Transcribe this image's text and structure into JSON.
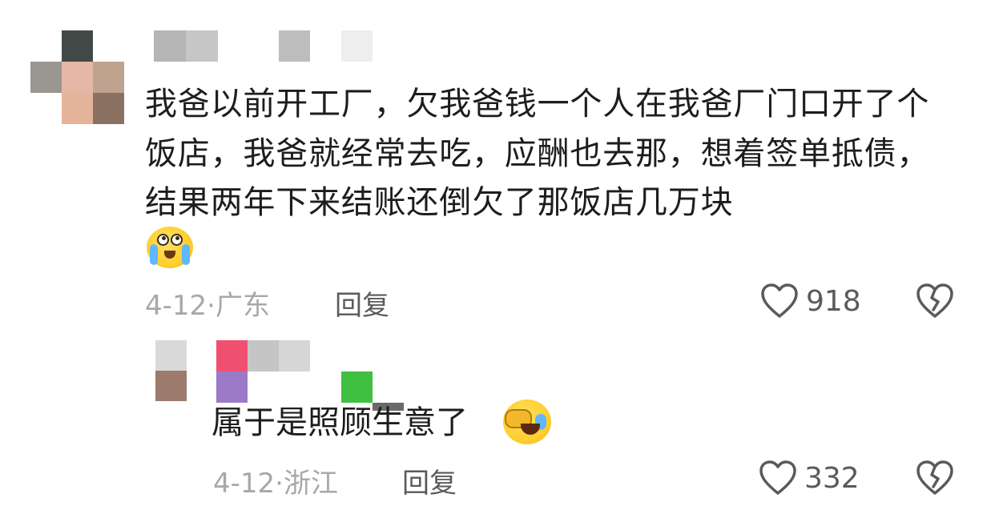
{
  "comment": {
    "text": "我爸以前开工厂，欠我爸钱一个人在我爸厂门口开了个饭店，我爸就经常去吃，应酬也去那，想着签单抵债，结果两年下来结账还倒欠了那饭店几万块",
    "emoji": "crying-laugh-emoji",
    "date": "4-12",
    "separator": "·",
    "location": "广东",
    "reply_label": "回复",
    "likes": "918"
  },
  "reply": {
    "text": "属于是照顾生意了",
    "emoji": "rofl-emoji",
    "date": "4-12",
    "separator": "·",
    "location": "浙江",
    "reply_label": "回复",
    "likes": "332"
  },
  "colors": {
    "text": "#1d1d1d",
    "meta": "#a8a8a8",
    "action": "#5a5a5a",
    "emoji_yellow": "#ffcf2e"
  }
}
